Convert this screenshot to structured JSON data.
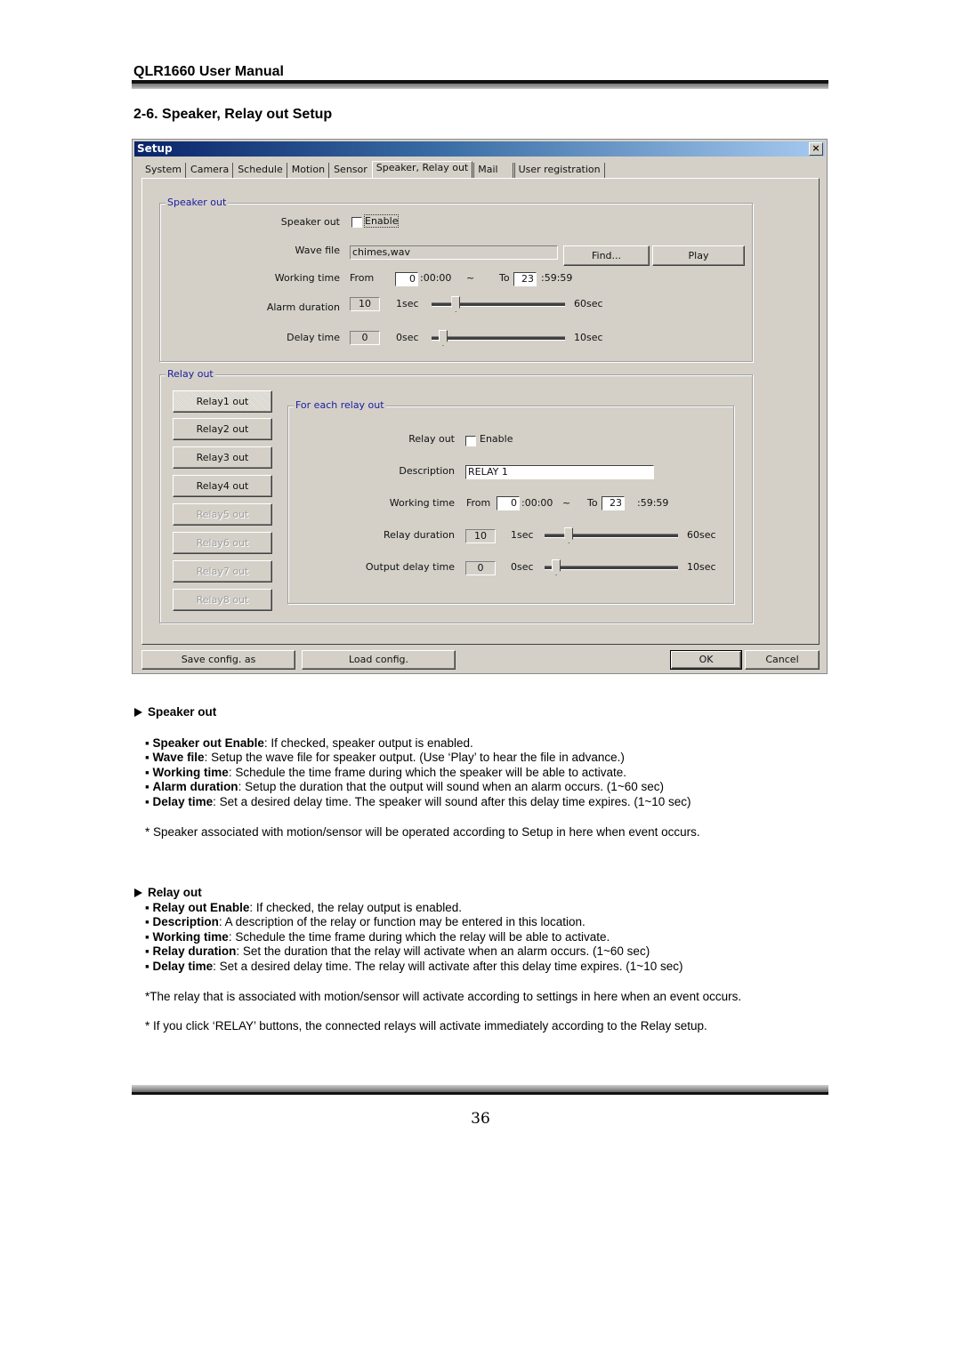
{
  "document": {
    "header_title": "QLR1660 User Manual",
    "section_title": "2-6. Speaker, Relay out Setup",
    "page_number": "36"
  },
  "dialog": {
    "title": "Setup",
    "close_glyph": "×",
    "tabs": [
      {
        "label": "System",
        "active": false
      },
      {
        "label": "Camera",
        "active": false
      },
      {
        "label": "Schedule",
        "active": false
      },
      {
        "label": "Motion",
        "active": false
      },
      {
        "label": "Sensor",
        "active": false
      },
      {
        "label": "Speaker, Relay out",
        "active": true
      },
      {
        "label": "Mail",
        "active": false
      },
      {
        "label": "User registration",
        "active": false
      }
    ],
    "speaker_out": {
      "group_label": "Speaker out",
      "enable_label": "Speaker out",
      "enable_checkbox_text": "Enable",
      "enabled": false,
      "wave_file_label": "Wave file",
      "wave_file_value": "chimes,wav",
      "find_button": "Find...",
      "play_button": "Play",
      "working_time_label": "Working time",
      "from_label": "From",
      "from_hour": "0",
      "from_suffix": ":00:00",
      "tilde": "~",
      "to_label": "To",
      "to_hour": "23",
      "to_suffix": ":59:59",
      "alarm_duration_label": "Alarm duration",
      "alarm_duration_value": "10",
      "alarm_min_label": "1sec",
      "alarm_max_label": "60sec",
      "alarm_slider": {
        "min": 1,
        "max": 60,
        "value": 10
      },
      "delay_time_label": "Delay time",
      "delay_time_value": "0",
      "delay_min_label": "0sec",
      "delay_max_label": "10sec",
      "delay_slider": {
        "min": 0,
        "max": 10,
        "value": 0
      }
    },
    "relay_out": {
      "group_label": "Relay out",
      "relay_buttons": [
        {
          "label": "Relay1 out",
          "enabled": true,
          "pressed": true
        },
        {
          "label": "Relay2 out",
          "enabled": true,
          "pressed": false
        },
        {
          "label": "Relay3 out",
          "enabled": true,
          "pressed": false
        },
        {
          "label": "Relay4 out",
          "enabled": true,
          "pressed": false
        },
        {
          "label": "Relay5 out",
          "enabled": false,
          "pressed": false
        },
        {
          "label": "Relay6 out",
          "enabled": false,
          "pressed": false
        },
        {
          "label": "Relay7 out",
          "enabled": false,
          "pressed": false
        },
        {
          "label": "Relay8 out",
          "enabled": false,
          "pressed": false
        }
      ],
      "each": {
        "group_label": "For each relay out",
        "enable_label": "Relay out",
        "enable_checkbox_text": "Enable",
        "enabled": false,
        "description_label": "Description",
        "description_value": "RELAY 1",
        "working_time_label": "Working time",
        "from_label": "From",
        "from_hour": "0",
        "from_suffix": ":00:00",
        "tilde": "~",
        "to_label": "To",
        "to_hour": "23",
        "to_suffix": ":59:59",
        "relay_duration_label": "Relay duration",
        "relay_duration_value": "10",
        "duration_min_label": "1sec",
        "duration_max_label": "60sec",
        "duration_slider": {
          "min": 1,
          "max": 60,
          "value": 10
        },
        "output_delay_label": "Output delay time",
        "output_delay_value": "0",
        "delay_min_label": "0sec",
        "delay_max_label": "10sec",
        "delay_slider": {
          "min": 0,
          "max": 10,
          "value": 0
        }
      }
    },
    "footer": {
      "save_button": "Save config. as",
      "load_button": "Load config.",
      "ok_button": "OK",
      "cancel_button": "Cancel"
    }
  },
  "body": {
    "speaker_heading": "Speaker out",
    "speaker_items": [
      {
        "term": "Speaker out Enable",
        "text": ": If checked, speaker output is enabled."
      },
      {
        "term": "Wave file",
        "text": ": Setup the wave file for speaker output. (Use ‘Play’ to hear the file in advance.)"
      },
      {
        "term": "Working time",
        "text": ": Schedule the time frame during which the speaker will be able to activate."
      },
      {
        "term": "Alarm duration",
        "text": ": Setup the duration that the output will sound when an alarm occurs. (1~60 sec)"
      },
      {
        "term": "Delay time",
        "text": ": Set a desired delay time. The speaker will sound after this delay time expires. (1~10 sec)"
      }
    ],
    "speaker_note": "* Speaker associated with motion/sensor will be operated according to Setup in here when event occurs.",
    "relay_heading": "Relay out",
    "relay_items": [
      {
        "term": "Relay out Enable",
        "text": ": If checked, the relay output is enabled."
      },
      {
        "term": "Description",
        "text": ": A description of the relay or function may be entered in this location."
      },
      {
        "term": "Working time",
        "text": ": Schedule the time frame during which the relay will be able to activate."
      },
      {
        "term": "Relay duration",
        "text": ": Set the duration that the relay will activate when an alarm occurs. (1~60 sec)"
      },
      {
        "term": "Delay time",
        "text": ": Set a desired delay time. The relay will activate after this delay time expires. (1~10 sec)"
      }
    ],
    "relay_note_1": "*The relay that is associated with motion/sensor will activate according to settings in here when an event occurs.",
    "relay_note_2": "* If you click ‘RELAY’ buttons, the connected relays will activate immediately according to the Relay setup.",
    "bullet": "▪"
  }
}
